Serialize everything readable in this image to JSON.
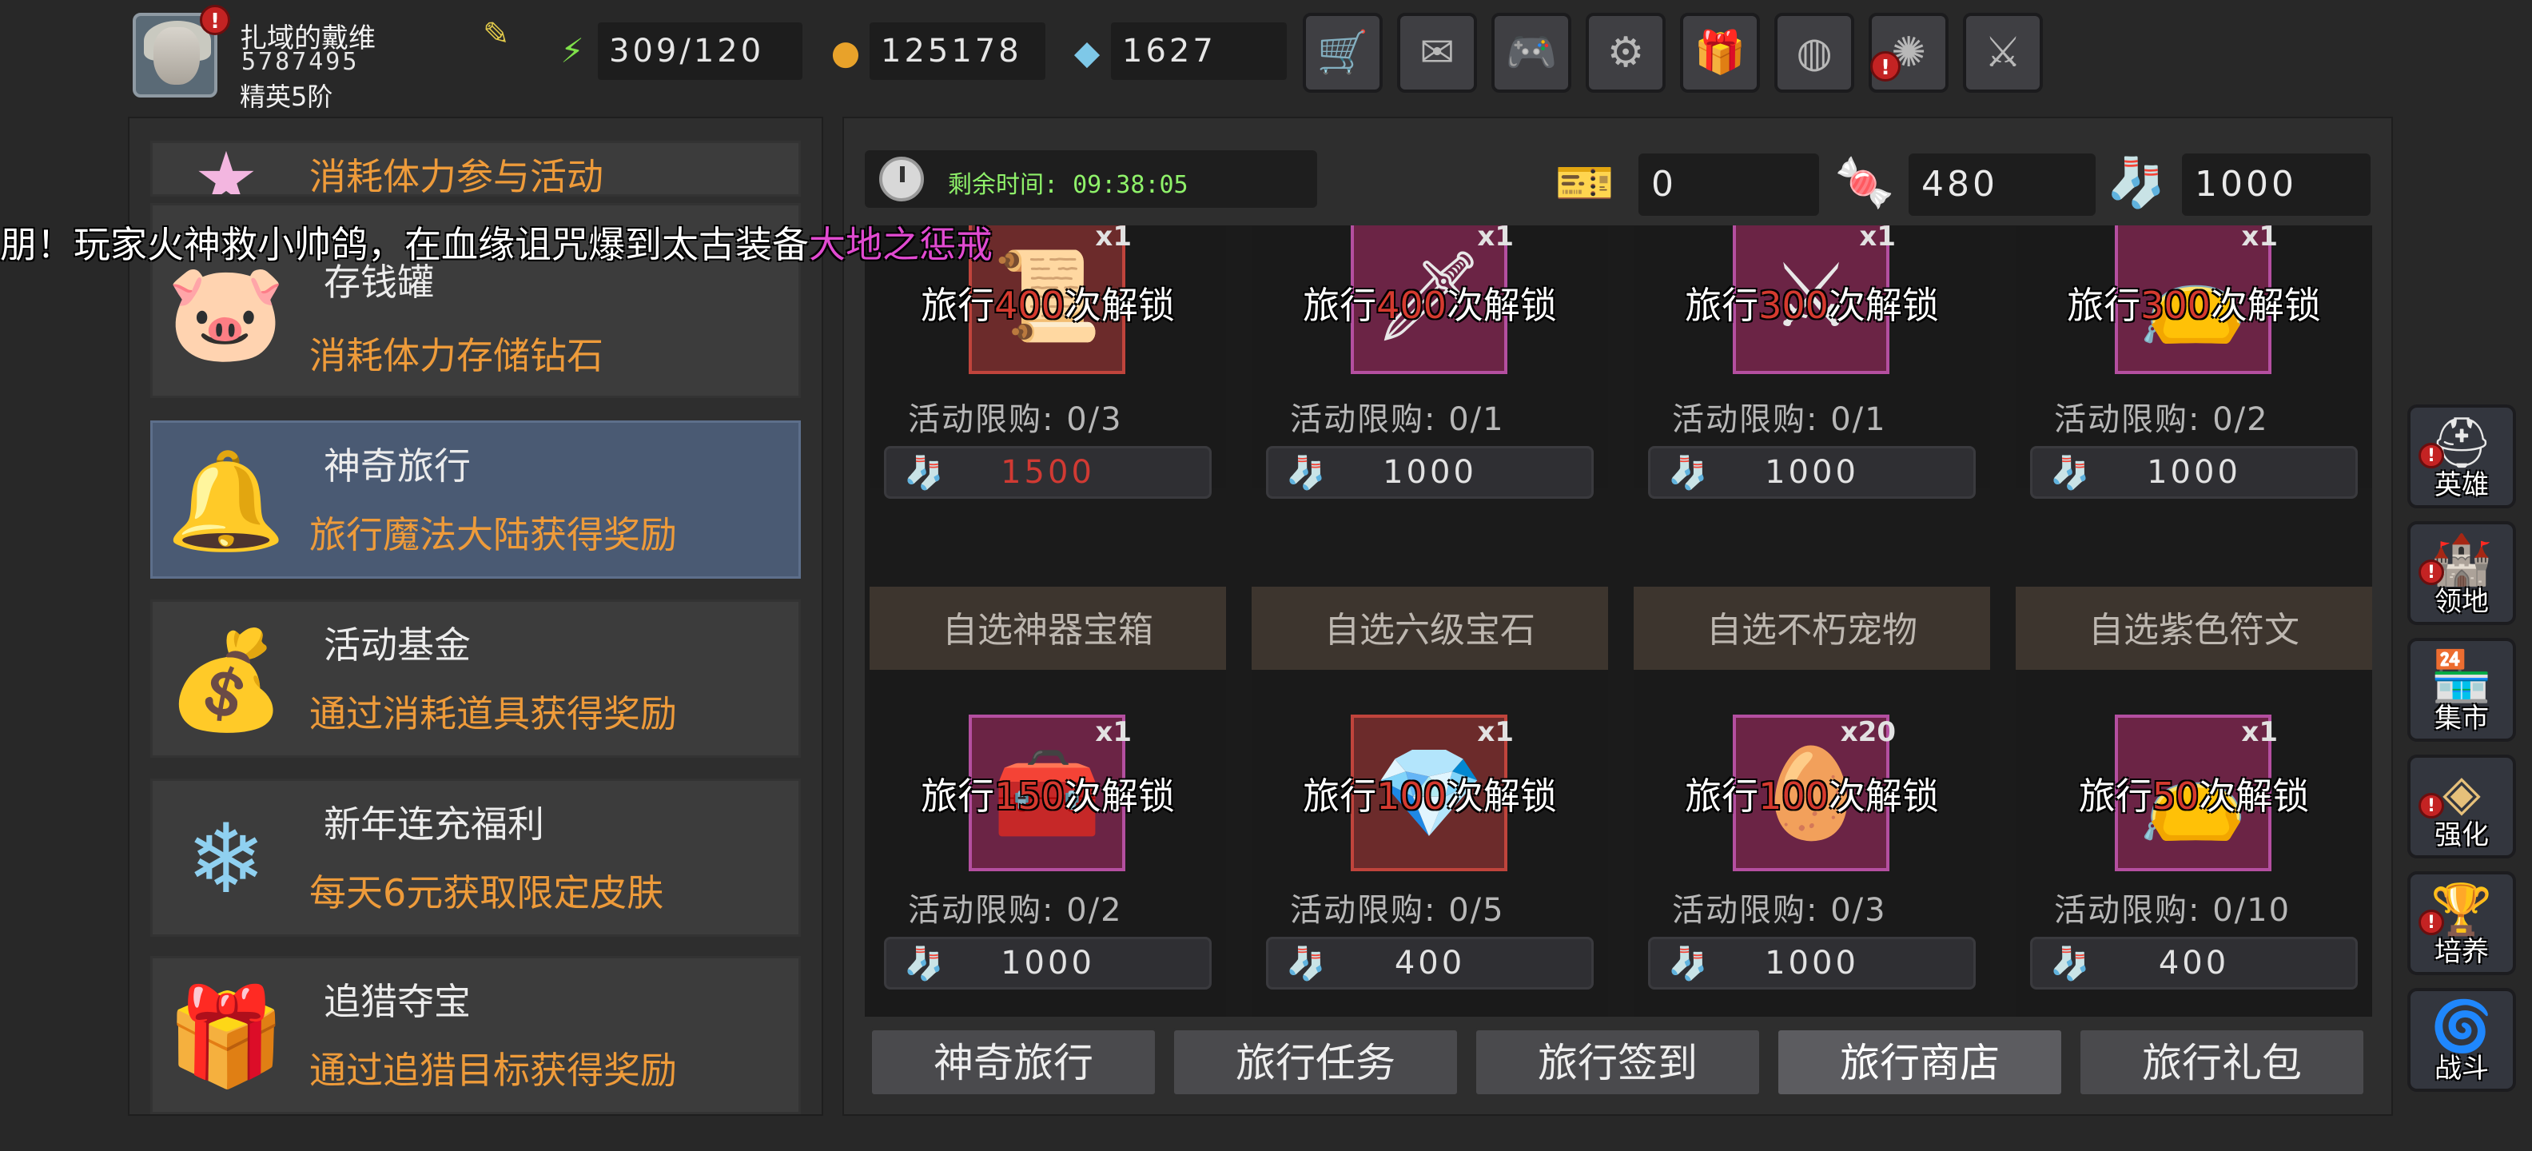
{
  "player": {
    "name": "扎域的戴维",
    "id": "5787495",
    "rank": "精英5阶"
  },
  "resources": {
    "stamina": "309/120",
    "gold": "125178",
    "diamond": "1627"
  },
  "toolbar": [
    "shop-cart-icon",
    "mail-icon",
    "gamepad-icon",
    "gear-icon",
    "gift-icon",
    "color-wheel-icon",
    "firework-icon",
    "battle-swords-icon"
  ],
  "marquee": {
    "prefix": "朋！玩家火神救小帅鸽，在血缘诅咒爆到太古装备",
    "highlight": "大地之惩戒"
  },
  "left_menu": [
    {
      "title": "",
      "desc": "消耗体力参与活动",
      "icon": "star-icon"
    },
    {
      "title": "存钱罐",
      "desc": "消耗体力存储钻石",
      "icon": "piggy-bank-icon"
    },
    {
      "title": "神奇旅行",
      "desc": "旅行魔法大陆获得奖励",
      "icon": "bells-icon",
      "active": true
    },
    {
      "title": "活动基金",
      "desc": "通过消耗道具获得奖励",
      "icon": "money-bag-icon"
    },
    {
      "title": "新年连充福利",
      "desc": "每天6元获取限定皮肤",
      "icon": "ice-crystal-icon"
    },
    {
      "title": "追猎夺宝",
      "desc": "通过追猎目标获得奖励",
      "icon": "treasure-chest-icon"
    }
  ],
  "header": {
    "time_label": "剩余时间: 09:38:05",
    "ticket": "0",
    "candy": "480",
    "sock": "1000"
  },
  "cards_row1": [
    {
      "qty": "x1",
      "unlock_pre": "旅行",
      "unlock_num": "400",
      "unlock_post": "次解锁",
      "limit": "活动限购: 0/3",
      "price": "1500",
      "price_red": true,
      "frame": "red"
    },
    {
      "qty": "x1",
      "unlock_pre": "旅行",
      "unlock_num": "400",
      "unlock_post": "次解锁",
      "limit": "活动限购: 0/1",
      "price": "1000",
      "frame": "purple"
    },
    {
      "qty": "x1",
      "unlock_pre": "旅行",
      "unlock_num": "300",
      "unlock_post": "次解锁",
      "limit": "活动限购: 0/1",
      "price": "1000",
      "frame": "purple"
    },
    {
      "qty": "x1",
      "unlock_pre": "旅行",
      "unlock_num": "300",
      "unlock_post": "次解锁",
      "limit": "活动限购: 0/2",
      "price": "1000",
      "frame": "purple"
    }
  ],
  "cards_row2": [
    {
      "name": "自选神器宝箱",
      "qty": "x1",
      "unlock_pre": "旅行",
      "unlock_num": "150",
      "unlock_post": "次解锁",
      "limit": "活动限购: 0/2",
      "price": "1000",
      "frame": "purple"
    },
    {
      "name": "自选六级宝石",
      "qty": "x1",
      "unlock_pre": "旅行",
      "unlock_num": "100",
      "unlock_post": "次解锁",
      "limit": "活动限购: 0/5",
      "price": "400",
      "frame": "red"
    },
    {
      "name": "自选不朽宠物",
      "qty": "x20",
      "unlock_pre": "旅行",
      "unlock_num": "100",
      "unlock_post": "次解锁",
      "limit": "活动限购: 0/3",
      "price": "1000",
      "frame": "purple"
    },
    {
      "name": "自选紫色符文",
      "qty": "x1",
      "unlock_pre": "旅行",
      "unlock_num": "50",
      "unlock_post": "次解锁",
      "limit": "活动限购: 0/10",
      "price": "400",
      "frame": "purple"
    }
  ],
  "tabs": [
    {
      "label": "神奇旅行"
    },
    {
      "label": "旅行任务"
    },
    {
      "label": "旅行签到"
    },
    {
      "label": "旅行商店",
      "active": true
    },
    {
      "label": "旅行礼包"
    }
  ],
  "right_nav": [
    {
      "label": "英雄",
      "icon": "helmet-icon",
      "alert": true
    },
    {
      "label": "领地",
      "icon": "castle-icon",
      "alert": true
    },
    {
      "label": "集市",
      "icon": "market-icon",
      "alert": false
    },
    {
      "label": "强化",
      "icon": "upgrade-gem-icon",
      "alert": true
    },
    {
      "label": "培养",
      "icon": "grail-icon",
      "alert": true
    },
    {
      "label": "战斗",
      "icon": "portal-icon",
      "alert": false
    }
  ],
  "colors": {
    "accent_orange": "#ee9b3a",
    "price_red": "#d13a33",
    "timer_green": "#8ff26a",
    "highlight_pink": "#e04ad0"
  }
}
